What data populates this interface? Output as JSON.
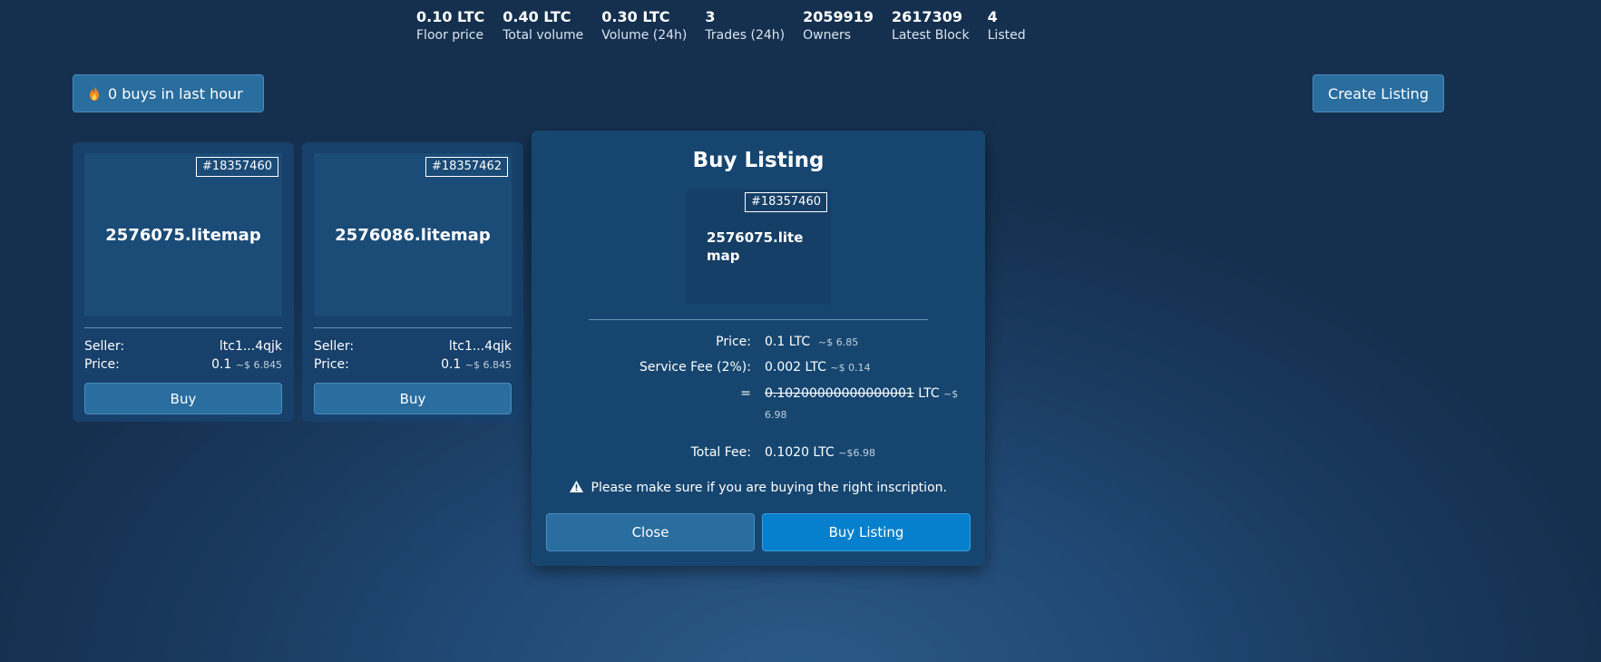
{
  "stats": [
    {
      "value": "0.10 LTC",
      "label": "Floor price"
    },
    {
      "value": "0.40 LTC",
      "label": "Total volume"
    },
    {
      "value": "0.30 LTC",
      "label": "Volume (24h)"
    },
    {
      "value": "3",
      "label": "Trades (24h)"
    },
    {
      "value": "2059919",
      "label": "Owners"
    },
    {
      "value": "2617309",
      "label": "Latest Block"
    },
    {
      "value": "4",
      "label": "Listed"
    }
  ],
  "toolbar": {
    "buys_label": "0 buys in last hour",
    "create_listing_label": "Create Listing"
  },
  "cards": [
    {
      "inscription": "#18357460",
      "name": "2576075.litemap",
      "seller_label": "Seller:",
      "seller": "ltc1...4qjk",
      "price_label": "Price:",
      "price": "0.1",
      "price_usd": "~$ 6.845",
      "buy_label": "Buy"
    },
    {
      "inscription": "#18357462",
      "name": "2576086.litemap",
      "seller_label": "Seller:",
      "seller": "ltc1...4qjk",
      "price_label": "Price:",
      "price": "0.1",
      "price_usd": "~$ 6.845",
      "buy_label": "Buy"
    }
  ],
  "modal": {
    "title": "Buy Listing",
    "inscription": "#18357460",
    "name": "2576075.litemap",
    "price_label": "Price:",
    "price_value": "0.1 LTC",
    "price_usd": "~$ 6.85",
    "fee_label": "Service Fee (2%):",
    "fee_value": "0.002 LTC",
    "fee_usd": "~$ 0.14",
    "sum_label": "=",
    "sum_value": "0.10200000000000001",
    "sum_unit": "LTC",
    "sum_usd": "~$ 6.98",
    "total_label": "Total Fee:",
    "total_value": "0.1020 LTC",
    "total_usd": "~$6.98",
    "warning": "Please make sure if you are buying the right inscription.",
    "close_label": "Close",
    "buy_label": "Buy Listing"
  }
}
